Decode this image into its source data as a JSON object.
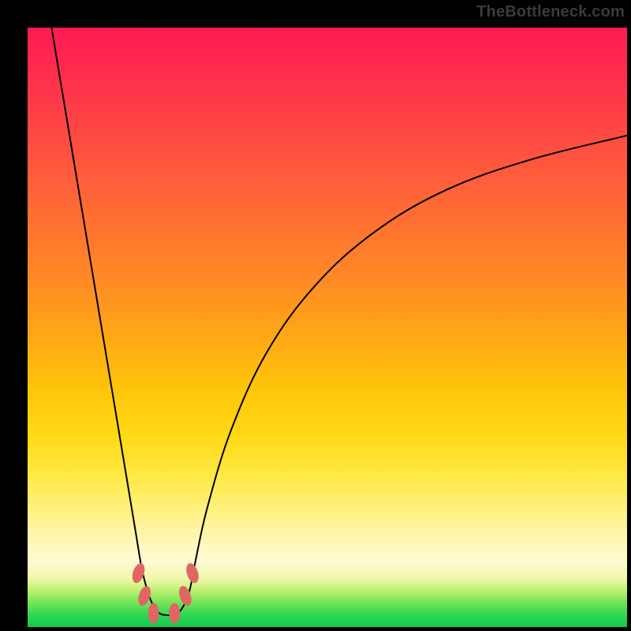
{
  "watermark": "TheBottleneck.com",
  "chart_data": {
    "type": "line",
    "title": "",
    "xlabel": "",
    "ylabel": "",
    "xlim": [
      0,
      100
    ],
    "ylim": [
      0,
      100
    ],
    "grid": false,
    "legend": false,
    "series": [
      {
        "name": "bottleneck-curve",
        "x": [
          4,
          6,
          8,
          10,
          12,
          14,
          16,
          18,
          19,
          20,
          21,
          22,
          23,
          24,
          25,
          26,
          27,
          28,
          30,
          34,
          40,
          48,
          58,
          70,
          84,
          100
        ],
        "y": [
          100,
          88,
          76,
          64,
          52,
          40,
          28,
          16,
          10,
          6,
          3.5,
          2.3,
          2.0,
          2.0,
          2.3,
          3.5,
          6,
          11,
          20,
          33,
          46,
          57,
          66,
          73,
          78,
          82
        ]
      }
    ],
    "markers": [
      {
        "name": "threshold-marker",
        "x": 18.5,
        "y": 9.0
      },
      {
        "name": "threshold-marker",
        "x": 19.5,
        "y": 5.2
      },
      {
        "name": "threshold-marker",
        "x": 21.0,
        "y": 2.3
      },
      {
        "name": "threshold-marker",
        "x": 24.5,
        "y": 2.3
      },
      {
        "name": "threshold-marker",
        "x": 26.3,
        "y": 5.2
      },
      {
        "name": "threshold-marker",
        "x": 27.5,
        "y": 9.0
      }
    ],
    "marker_style": {
      "color": "#e06666",
      "rx": 7,
      "ry": 13
    },
    "curve_color": "#000000",
    "curve_width": 2
  }
}
